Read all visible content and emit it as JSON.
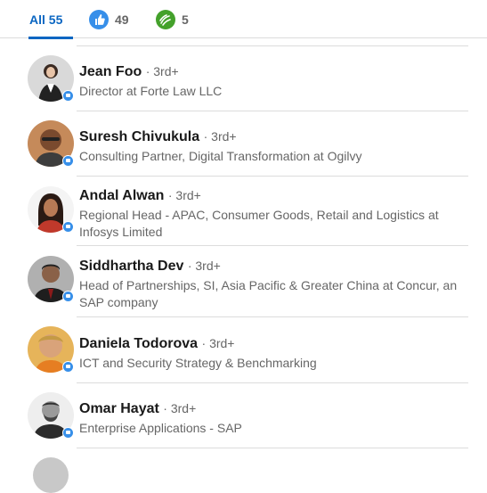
{
  "tabs": [
    {
      "label": "All 55",
      "icon": "",
      "active": true
    },
    {
      "label": "49",
      "icon": "like-icon",
      "active": false
    },
    {
      "label": "5",
      "icon": "celebrate-icon",
      "active": false
    }
  ],
  "people": [
    {
      "name": "Jean Foo",
      "degree": "· 3rd+",
      "headline": "Director at Forte Law LLC"
    },
    {
      "name": "Suresh Chivukula",
      "degree": "· 3rd+",
      "headline": "Consulting Partner, Digital Transformation at Ogilvy"
    },
    {
      "name": "Andal Alwan",
      "degree": "· 3rd+",
      "headline": "Regional Head - APAC, Consumer Goods, Retail and Logistics at Infosys Limited"
    },
    {
      "name": "Siddhartha Dev",
      "degree": "· 3rd+",
      "headline": "Head of Partnerships, SI, Asia Pacific & Greater China at Concur, an SAP company"
    },
    {
      "name": "Daniela Todorova",
      "degree": "· 3rd+",
      "headline": "ICT and Security Strategy & Benchmarking"
    },
    {
      "name": "Omar Hayat",
      "degree": "· 3rd+",
      "headline": "Enterprise Applications - SAP"
    }
  ],
  "colors": {
    "accent": "#0a66c2",
    "like": "#378fe9",
    "celebrate": "#44a12b"
  }
}
